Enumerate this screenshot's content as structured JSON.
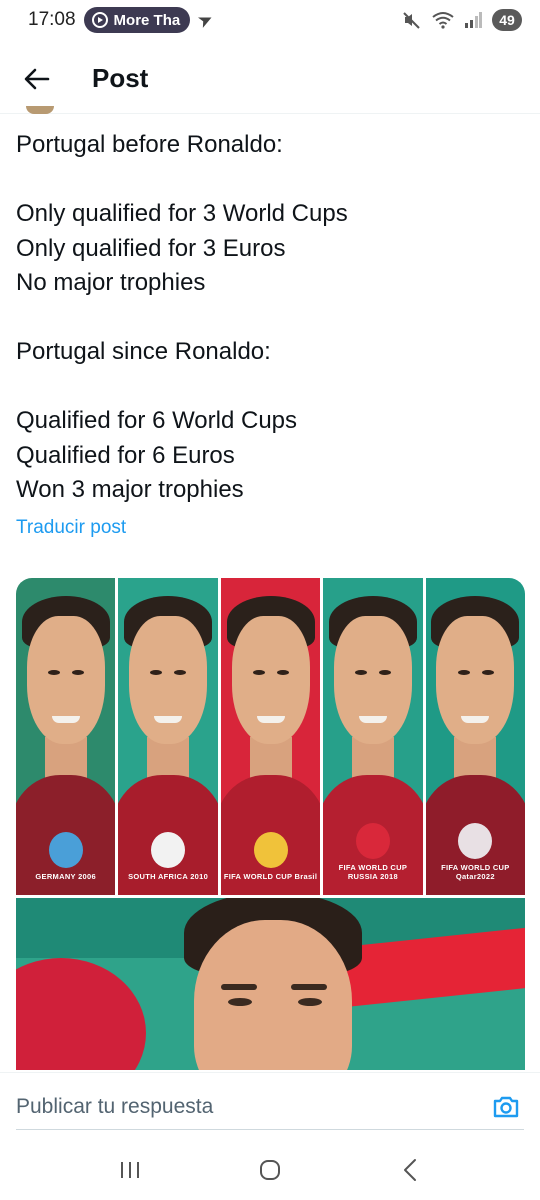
{
  "status_bar": {
    "time": "17:08",
    "notification_pill": "More Tha",
    "battery": "49"
  },
  "header": {
    "title": "Post",
    "back_icon": "arrow-left-icon"
  },
  "post": {
    "lines": [
      "Portugal before Ronaldo:",
      "",
      "Only qualified for 3 World Cups",
      "Only qualified for 3 Euros",
      "No major trophies",
      "",
      "Portugal since Ronaldo:",
      "",
      "Qualified for 6 World Cups",
      "Qualified for 6 Euros",
      "Won 3 major trophies"
    ],
    "translate_label": "Traducir post"
  },
  "media": {
    "panels": [
      {
        "emblem_text": "GERMANY 2006",
        "bg": "#2d8a6c",
        "shirt": "#8c1f2a",
        "emblem_color": "#4a9fd8"
      },
      {
        "emblem_text": "SOUTH AFRICA 2010",
        "bg": "#2aa38c",
        "shirt": "#a81d2c",
        "emblem_color": "#f2f2f2"
      },
      {
        "emblem_text": "FIFA WORLD CUP Brasil",
        "bg": "#d8253a",
        "shirt": "#b01e2e",
        "emblem_color": "#f0c23a"
      },
      {
        "emblem_text": "FIFA WORLD CUP RUSSIA 2018",
        "bg": "#27a08a",
        "shirt": "#b51f30",
        "emblem_color": "#d9283a"
      },
      {
        "emblem_text": "FIFA WORLD CUP Qatar2022",
        "bg": "#1f9a86",
        "shirt": "#8f1c2a",
        "emblem_color": "#e8e0e4"
      }
    ]
  },
  "reply": {
    "placeholder": "Publicar tu respuesta",
    "camera_icon": "camera-icon"
  },
  "nav": {
    "recents_icon": "recents-icon",
    "home_icon": "home-icon",
    "back_icon": "back-chevron-icon"
  },
  "colors": {
    "link": "#1d9bf0",
    "text": "#0f1419",
    "muted": "#536471"
  }
}
